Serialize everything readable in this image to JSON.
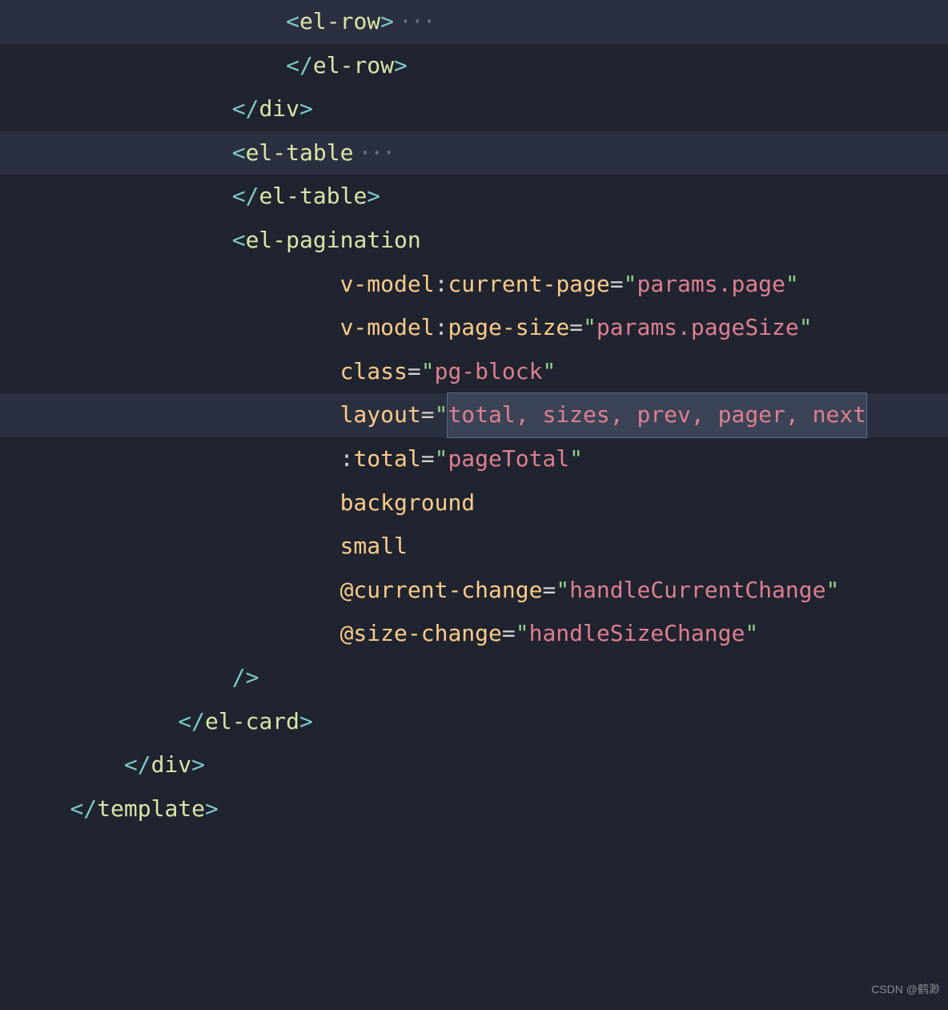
{
  "watermark": "CSDN @鹤渺",
  "fold": "···",
  "lines": [
    {
      "indent": "     ",
      "hl": true,
      "fold": true,
      "tokens": [
        {
          "c": "p",
          "t": "<"
        },
        {
          "c": "tag",
          "t": "el-row"
        },
        {
          "c": "p",
          "t": ">"
        }
      ]
    },
    {
      "indent": "     ",
      "tokens": [
        {
          "c": "p",
          "t": "</"
        },
        {
          "c": "tag",
          "t": "el-row"
        },
        {
          "c": "p",
          "t": ">"
        }
      ]
    },
    {
      "indent": "    ",
      "tokens": [
        {
          "c": "p",
          "t": "</"
        },
        {
          "c": "tag",
          "t": "div"
        },
        {
          "c": "p",
          "t": ">"
        }
      ]
    },
    {
      "indent": "    ",
      "hl": true,
      "fold": true,
      "tokens": [
        {
          "c": "p",
          "t": "<"
        },
        {
          "c": "tag",
          "t": "el-table"
        }
      ]
    },
    {
      "indent": "    ",
      "tokens": [
        {
          "c": "p",
          "t": "</"
        },
        {
          "c": "tag",
          "t": "el-table"
        },
        {
          "c": "p",
          "t": ">"
        }
      ]
    },
    {
      "indent": "    ",
      "tokens": [
        {
          "c": "p",
          "t": "<"
        },
        {
          "c": "tag",
          "t": "el-pagination"
        }
      ]
    },
    {
      "indent": "      ",
      "tokens": [
        {
          "c": "attr",
          "t": "v-model"
        },
        {
          "c": "op",
          "t": ":"
        },
        {
          "c": "attr",
          "t": "current-page"
        },
        {
          "c": "op",
          "t": "="
        },
        {
          "c": "str",
          "t": "\""
        },
        {
          "c": "val",
          "t": "params.page"
        },
        {
          "c": "str",
          "t": "\""
        }
      ]
    },
    {
      "indent": "      ",
      "tokens": [
        {
          "c": "attr",
          "t": "v-model"
        },
        {
          "c": "op",
          "t": ":"
        },
        {
          "c": "attr",
          "t": "page-size"
        },
        {
          "c": "op",
          "t": "="
        },
        {
          "c": "str",
          "t": "\""
        },
        {
          "c": "val",
          "t": "params.pageSize"
        },
        {
          "c": "str",
          "t": "\""
        }
      ]
    },
    {
      "indent": "      ",
      "tokens": [
        {
          "c": "attr",
          "t": "class"
        },
        {
          "c": "op",
          "t": "="
        },
        {
          "c": "str",
          "t": "\""
        },
        {
          "c": "val",
          "t": "pg-block"
        },
        {
          "c": "str",
          "t": "\""
        }
      ]
    },
    {
      "indent": "      ",
      "hl": true,
      "tokens": [
        {
          "c": "attr",
          "t": "layout"
        },
        {
          "c": "op",
          "t": "="
        },
        {
          "c": "str",
          "t": "\""
        },
        {
          "c": "val",
          "t": "total, sizes, prev, pager, next",
          "sel": true
        },
        {
          "c": "str",
          "t": ""
        }
      ]
    },
    {
      "indent": "      ",
      "tokens": [
        {
          "c": "op",
          "t": ":"
        },
        {
          "c": "attr",
          "t": "total"
        },
        {
          "c": "op",
          "t": "="
        },
        {
          "c": "str",
          "t": "\""
        },
        {
          "c": "val",
          "t": "pageTotal"
        },
        {
          "c": "str",
          "t": "\""
        }
      ]
    },
    {
      "indent": "      ",
      "tokens": [
        {
          "c": "attr",
          "t": "background"
        }
      ]
    },
    {
      "indent": "      ",
      "tokens": [
        {
          "c": "attr",
          "t": "small"
        }
      ]
    },
    {
      "indent": "      ",
      "tokens": [
        {
          "c": "attr",
          "t": "@current-change"
        },
        {
          "c": "op",
          "t": "="
        },
        {
          "c": "str",
          "t": "\""
        },
        {
          "c": "val",
          "t": "handleCurrentChange"
        },
        {
          "c": "str",
          "t": "\""
        }
      ]
    },
    {
      "indent": "      ",
      "tokens": [
        {
          "c": "attr",
          "t": "@size-change"
        },
        {
          "c": "op",
          "t": "="
        },
        {
          "c": "str",
          "t": "\""
        },
        {
          "c": "val",
          "t": "handleSizeChange"
        },
        {
          "c": "str",
          "t": "\""
        }
      ]
    },
    {
      "indent": "    ",
      "tokens": [
        {
          "c": "p",
          "t": "/>"
        }
      ]
    },
    {
      "indent": "   ",
      "tokens": [
        {
          "c": "p",
          "t": "</"
        },
        {
          "c": "tag",
          "t": "el-card"
        },
        {
          "c": "p",
          "t": ">"
        }
      ]
    },
    {
      "indent": "  ",
      "tokens": [
        {
          "c": "p",
          "t": "</"
        },
        {
          "c": "tag",
          "t": "div"
        },
        {
          "c": "p",
          "t": ">"
        }
      ]
    },
    {
      "indent": " ",
      "tokens": [
        {
          "c": "p",
          "t": "</"
        },
        {
          "c": "tag",
          "t": "template"
        },
        {
          "c": "p",
          "t": ">"
        }
      ]
    }
  ]
}
